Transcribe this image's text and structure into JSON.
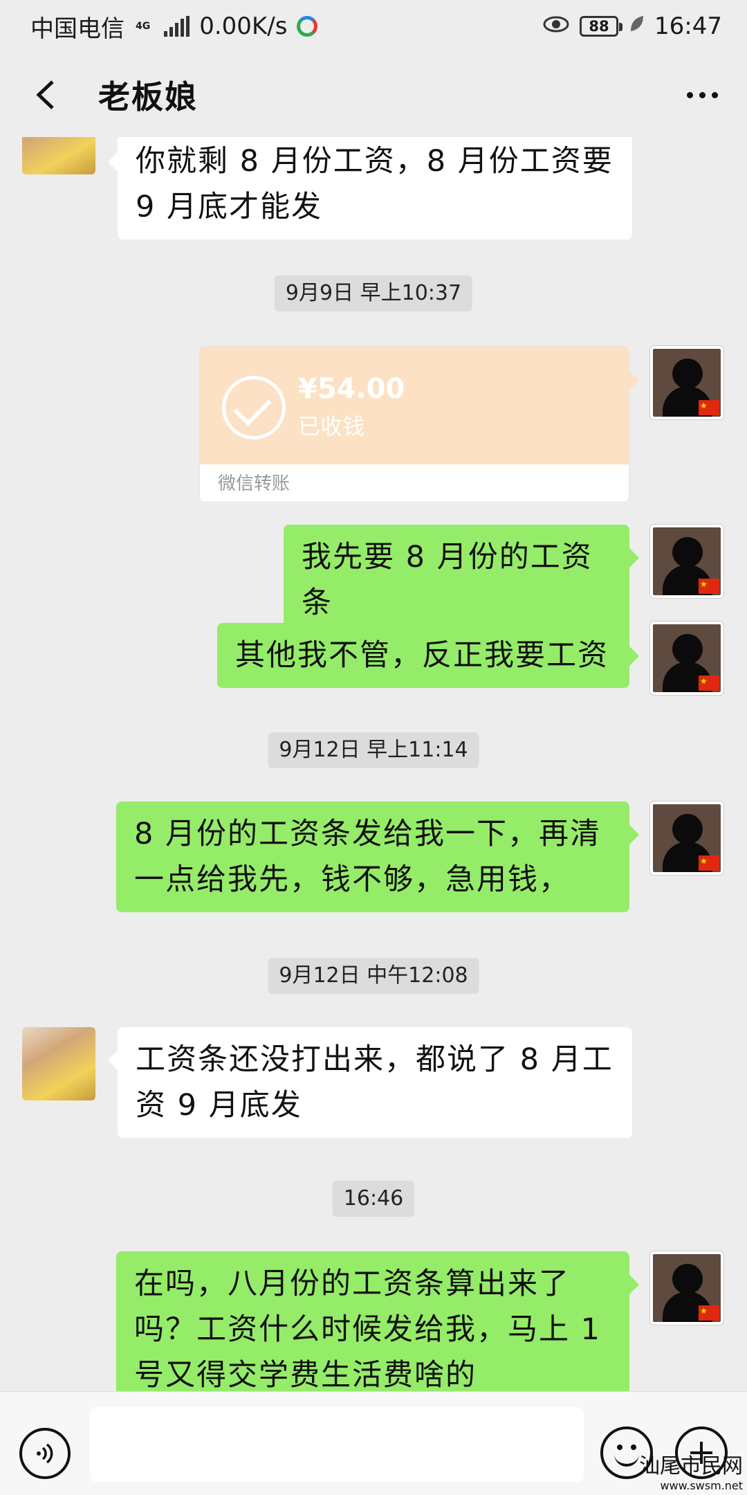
{
  "status_bar": {
    "carrier": "中国电信",
    "network": "4G",
    "speed": "0.00K/s",
    "battery": "88",
    "time": "16:47"
  },
  "header": {
    "title": "老板娘"
  },
  "messages": [
    {
      "from": "boss",
      "type": "text",
      "text": "你就剩 8 月份工资，8 月份工资要 9 月底才能发"
    },
    {
      "type": "timestamp",
      "text": "9月9日 早上10:37"
    },
    {
      "from": "me",
      "type": "transfer",
      "amount": "¥54.00",
      "status": "已收钱",
      "label": "微信转账"
    },
    {
      "from": "me",
      "type": "text",
      "text": "我先要 8 月份的工资条"
    },
    {
      "from": "me",
      "type": "text",
      "text": "其他我不管，反正我要工资"
    },
    {
      "type": "timestamp",
      "text": "9月12日 早上11:14"
    },
    {
      "from": "me",
      "type": "text",
      "text": "8 月份的工资条发给我一下，再清一点给我先，钱不够，急用钱，"
    },
    {
      "type": "timestamp",
      "text": "9月12日 中午12:08"
    },
    {
      "from": "boss",
      "type": "text",
      "text": "工资条还没打出来，都说了 8 月工资 9 月底发"
    },
    {
      "type": "timestamp",
      "text": "16:46"
    },
    {
      "from": "me",
      "type": "text",
      "text": "在吗，八月份的工资条算出来了吗？工资什么时候发给我，马上 1 号又得交学费生活费啥的"
    }
  ],
  "input_bar": {
    "voice_icon": "voice-icon",
    "emoji_icon": "emoji-icon",
    "plus_icon": "plus-icon"
  },
  "watermark": {
    "text": "汕尾市民网",
    "url": "www.swsm.net"
  },
  "colors": {
    "outgoing_bubble": "#95ec69",
    "incoming_bubble": "#ffffff",
    "transfer_card": "#fce1c4",
    "background": "#ededed"
  }
}
